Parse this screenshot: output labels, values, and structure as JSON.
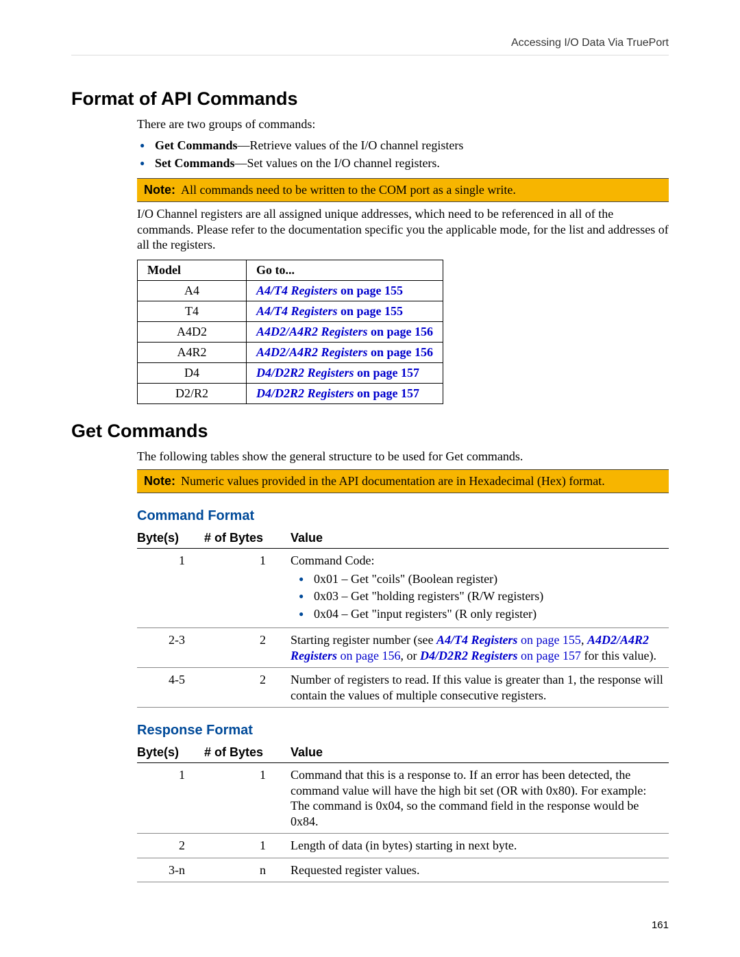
{
  "header": {
    "right": "Accessing I/O Data Via TruePort"
  },
  "sec1": {
    "title": "Format of API Commands",
    "intro": "There are two groups of commands:",
    "bullet1_bold": "Get Commands",
    "bullet1_rest": "—Retrieve values of the I/O channel registers",
    "bullet2_bold": "Set Commands",
    "bullet2_rest": "—Set values on the I/O channel registers.",
    "note_label": "Note:",
    "note_text": "All commands need to be written to the COM port as a single write.",
    "after_note": "I/O Channel registers are all assigned unique addresses, which need to be referenced in all of the commands. Please refer to the documentation specific you the applicable mode, for the list and addresses of all the registers."
  },
  "model_table": {
    "h1": "Model",
    "h2": "Go to...",
    "rows": [
      {
        "m": "A4",
        "link": "A4/T4 Registers",
        "trail": " on page 155"
      },
      {
        "m": "T4",
        "link": "A4/T4 Registers",
        "trail": " on page 155"
      },
      {
        "m": "A4D2",
        "link": "A4D2/A4R2 Registers",
        "trail": " on page 156"
      },
      {
        "m": "A4R2",
        "link": "A4D2/A4R2 Registers",
        "trail": " on page 156"
      },
      {
        "m": "D4",
        "link": "D4/D2R2 Registers",
        "trail": " on page 157"
      },
      {
        "m": "D2/R2",
        "link": "D4/D2R2 Registers",
        "trail": " on page 157"
      }
    ]
  },
  "sec2": {
    "title": "Get Commands",
    "intro": "The following tables show the general structure to be used for Get commands.",
    "note_label": "Note:",
    "note_text": "Numeric values provided in the API documentation are in Hexadecimal (Hex) format."
  },
  "cmd_format": {
    "title": "Command Format",
    "h1": "Byte(s)",
    "h2": "# of Bytes",
    "h3": "Value",
    "r1_b": "1",
    "r1_n": "1",
    "r1_v_lead": "Command Code:",
    "r1_li1": "0x01 – Get \"coils\" (Boolean register)",
    "r1_li2": "0x03 – Get \"holding registers\" (R/W registers)",
    "r1_li3": "0x04 – Get \"input registers\" (R only register)",
    "r2_b": "2-3",
    "r2_n": "2",
    "r2_pre": "Starting register number (see ",
    "r2_l1": "A4/T4 Registers",
    "r2_t1": " on page 155",
    "r2_sep1": ", ",
    "r2_l2": "A4D2/A4R2 Registers",
    "r2_t2": " on page 156",
    "r2_sep2": ", or ",
    "r2_l3": "D4/D2R2 Registers",
    "r2_t3": " on page 157",
    "r2_post": " for this value).",
    "r3_b": "4-5",
    "r3_n": "2",
    "r3_v": "Number of registers to read. If this value is greater than 1, the response will contain the values of multiple consecutive registers."
  },
  "resp_format": {
    "title": "Response Format",
    "h1": "Byte(s)",
    "h2": "# of Bytes",
    "h3": "Value",
    "r1_b": "1",
    "r1_n": "1",
    "r1_v": "Command that this is a response to. If an error has been detected, the command value will have the high bit set (OR with 0x80). For example: The command is 0x04, so the command field in the response would be 0x84.",
    "r2_b": "2",
    "r2_n": "1",
    "r2_v": "Length of data (in bytes) starting in next byte.",
    "r3_b": "3-n",
    "r3_n": "n",
    "r3_v": "Requested register values."
  },
  "pagenum": "161"
}
